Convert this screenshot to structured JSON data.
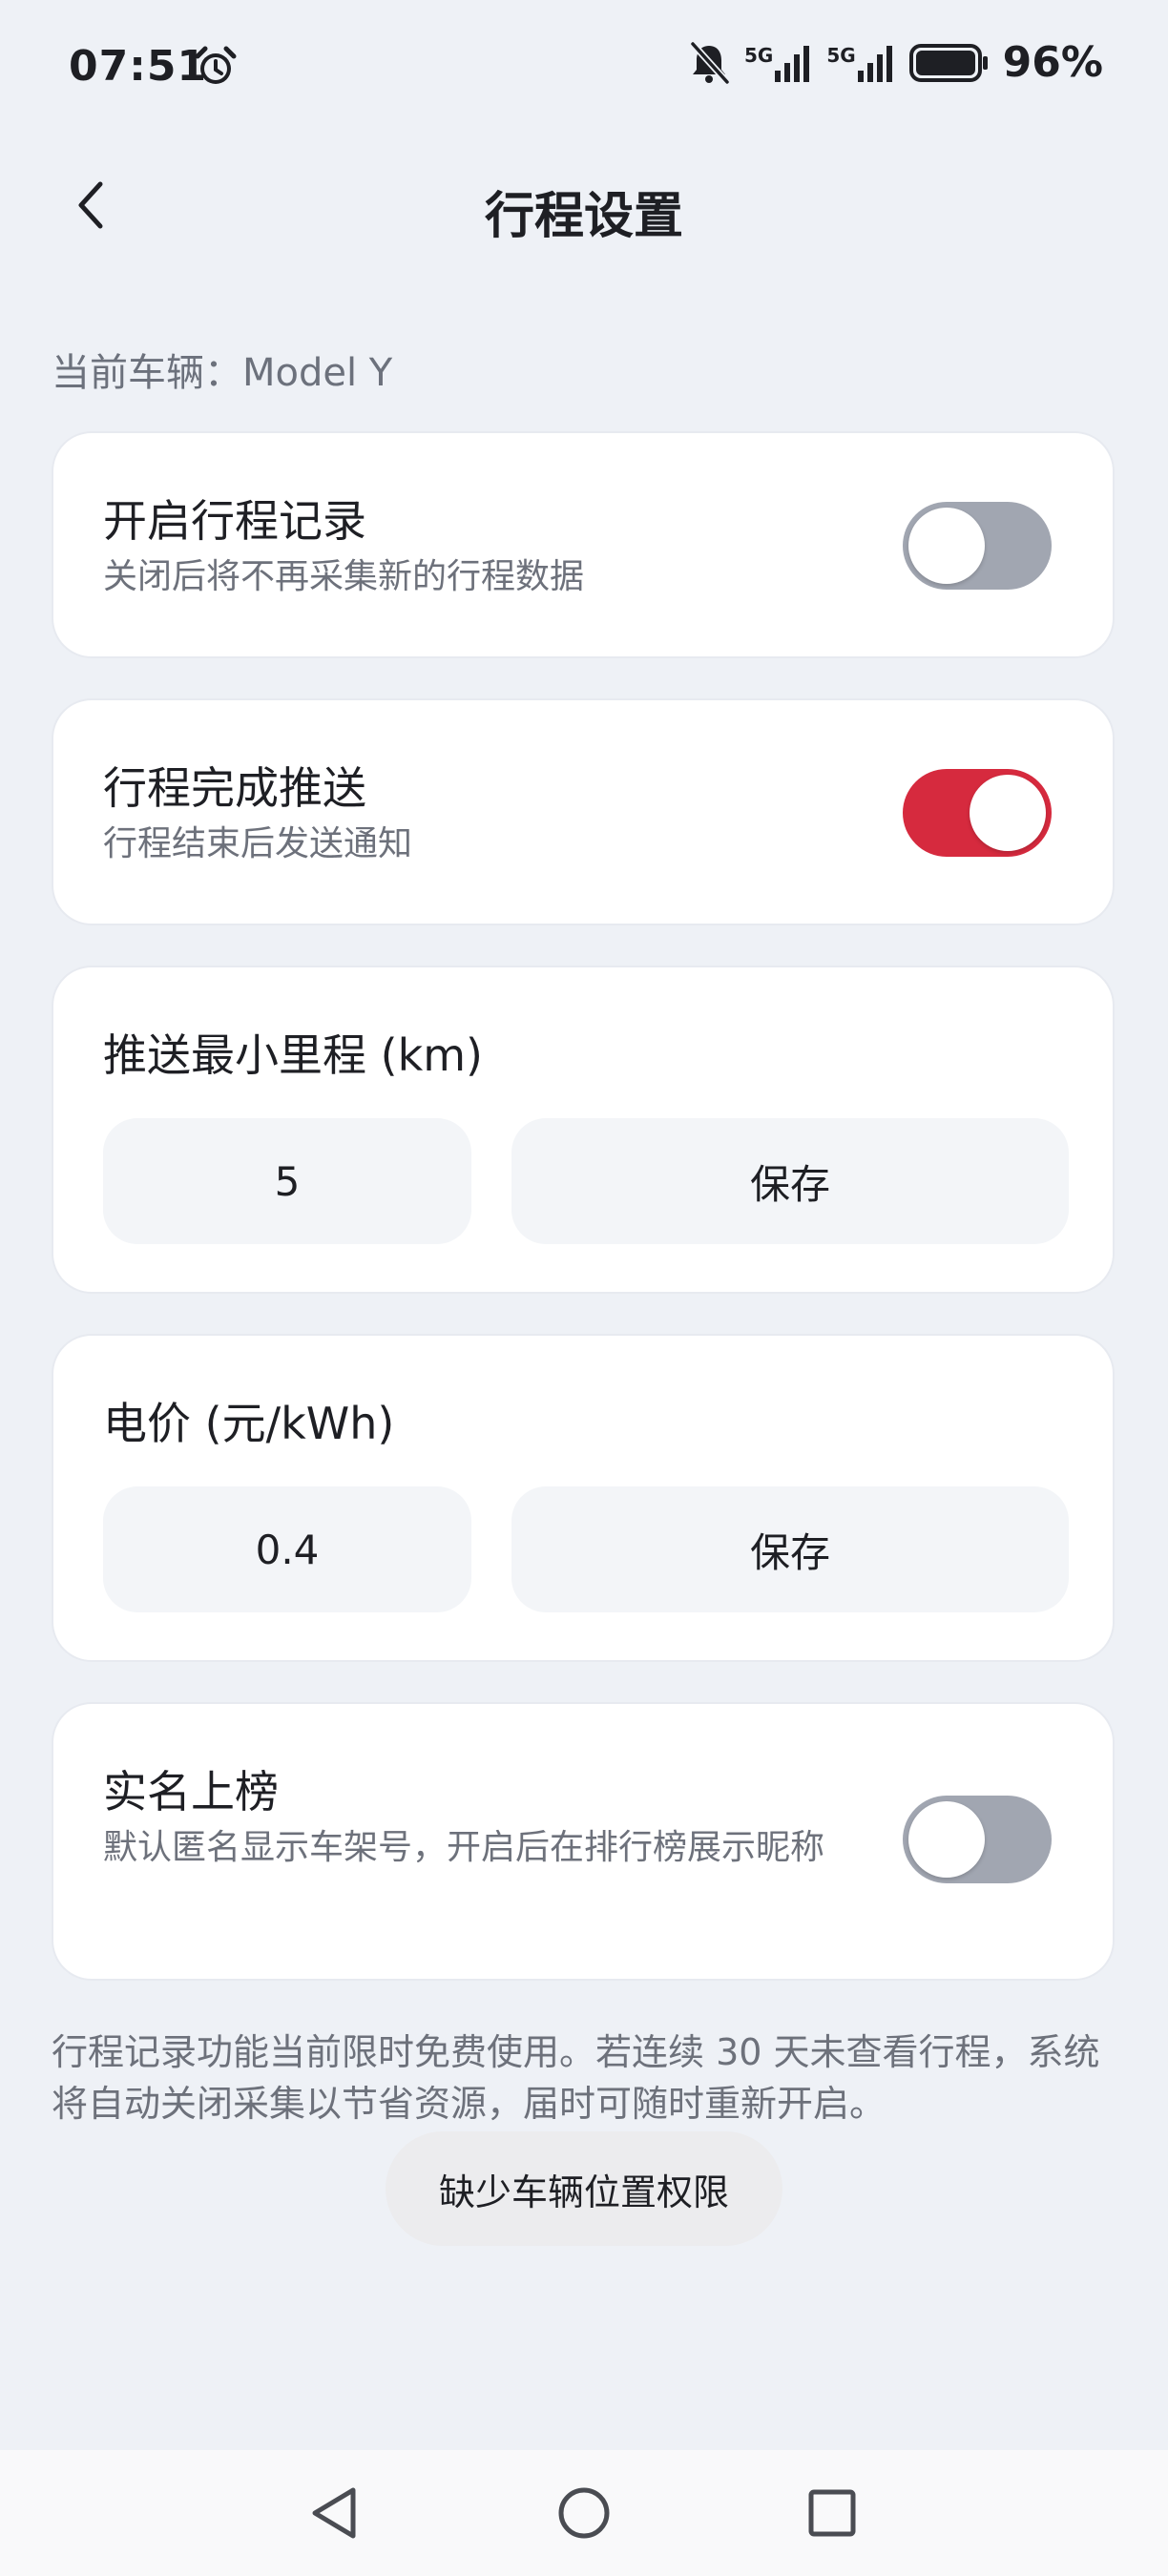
{
  "status_bar": {
    "time": "07:51",
    "alarm_icon": "alarm-clock-icon",
    "mute_icon": "bell-off-icon",
    "network_1": "5G",
    "network_2": "5G",
    "battery_icon": "battery-icon",
    "battery_percent": "96%",
    "battery_level": 0.96
  },
  "header": {
    "back_icon": "chevron-left-icon",
    "title": "行程设置"
  },
  "current_vehicle": "当前车辆：Model Y",
  "settings": {
    "trip_record": {
      "title": "开启行程记录",
      "desc": "关闭后将不再采集新的行程数据",
      "enabled": false
    },
    "trip_push": {
      "title": "行程完成推送",
      "desc": "行程结束后发送通知",
      "enabled": true
    },
    "min_distance": {
      "title": "推送最小里程 (km)",
      "value": "5",
      "save_label": "保存"
    },
    "electricity_price": {
      "title": "电价 (元/kWh)",
      "value": "0.4",
      "save_label": "保存"
    },
    "real_name_rank": {
      "title": "实名上榜",
      "desc": "默认匿名显示车架号，开启后在排行榜展示昵称",
      "enabled": false
    }
  },
  "footnote": "行程记录功能当前限时免费使用。若连续 30 天未查看行程，系统将自动关闭采集以节省资源，届时可随时重新开启。",
  "toast": "缺少车辆位置权限",
  "colors": {
    "accent": "#d62a3e",
    "toggle_off": "#a1a6b1",
    "background": "#eef1f6"
  },
  "nav_bar": {
    "back_icon": "triangle-back-icon",
    "home_icon": "circle-home-icon",
    "recents_icon": "square-recents-icon"
  }
}
